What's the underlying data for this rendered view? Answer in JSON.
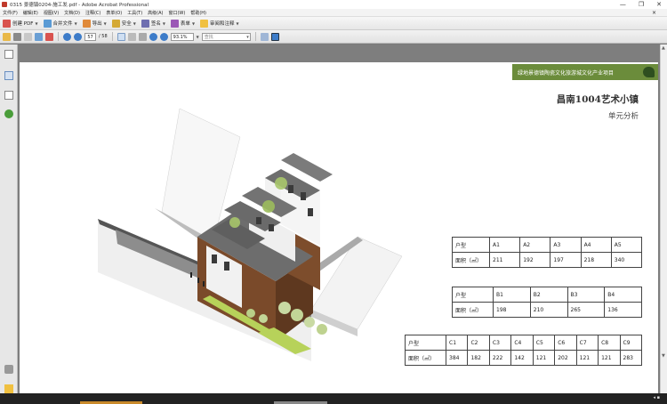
{
  "window": {
    "title": "0315 景德镇0204-施工发.pdf - Adobe Acrobat Professional",
    "controls": {
      "minimize": "—",
      "maximize": "❐",
      "close": "✕"
    }
  },
  "menu": {
    "items": [
      "文件(F)",
      "编辑(E)",
      "视图(V)",
      "文档(D)",
      "注释(C)",
      "表单(O)",
      "工具(T)",
      "高级(A)",
      "窗口(W)",
      "帮助(H)"
    ],
    "close": "×"
  },
  "toolbar1": {
    "create_pdf": "创建 PDF",
    "combine": "合并文件",
    "export": "导出",
    "secure": "安全",
    "sign": "签名",
    "forms": "表单",
    "review": "审阅和注释"
  },
  "toolbar2": {
    "current_page": "57",
    "total_pages": "/ 58",
    "zoom": "93.1%",
    "search_placeholder": "查找"
  },
  "document": {
    "header_band": "绿地景德镇陶瓷文化旅游城文化产业项目",
    "title": "昌南1004艺术小镇",
    "subtitle": "单元分析",
    "table_a": {
      "label_type": "户型",
      "label_area": "面积（㎡）",
      "types": [
        "A1",
        "A2",
        "A3",
        "A4",
        "A5"
      ],
      "areas": [
        "211",
        "192",
        "197",
        "218",
        "340"
      ]
    },
    "table_b": {
      "label_type": "户型",
      "label_area": "面积（㎡）",
      "types": [
        "B1",
        "B2",
        "B3",
        "B4"
      ],
      "areas": [
        "198",
        "210",
        "265",
        "136"
      ]
    },
    "table_c": {
      "label_type": "户型",
      "label_area": "面积（㎡）",
      "types": [
        "C1",
        "C2",
        "C3",
        "C4",
        "C5",
        "C6",
        "C7",
        "C8",
        "C9"
      ],
      "areas": [
        "384",
        "182",
        "222",
        "142",
        "121",
        "202",
        "121",
        "121",
        "283"
      ]
    }
  },
  "colors": {
    "header_band": "#6b8c3b",
    "brick": "#7a4a2a",
    "roof": "#6d6d6d",
    "wall": "#f4f4f4",
    "grass": "#b7d25a"
  }
}
